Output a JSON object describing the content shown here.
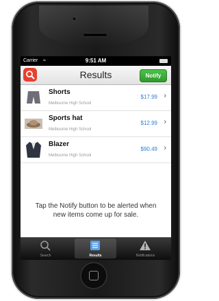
{
  "status_bar": {
    "carrier": "Carrier",
    "time": "9:51 AM"
  },
  "nav": {
    "title": "Results",
    "notify_label": "Notify"
  },
  "items": [
    {
      "title": "Shorts",
      "subtitle": "Melbourne High School",
      "price": "$17.99"
    },
    {
      "title": "Sports hat",
      "subtitle": "Melbourne High School",
      "price": "$12.99"
    },
    {
      "title": "Blazer",
      "subtitle": "Melbourne High School",
      "price": "$90.49"
    }
  ],
  "message": "Tap the Notify button to be alerted when new items come up for sale.",
  "tabs": [
    {
      "label": "Search",
      "icon": "search-icon"
    },
    {
      "label": "Results",
      "icon": "results-list-icon",
      "active": true
    },
    {
      "label": "Notifications",
      "icon": "warning-icon"
    }
  ],
  "colors": {
    "accent": "#2d7fd6",
    "notify": "#3aad37",
    "app_icon": "#e8402f"
  }
}
